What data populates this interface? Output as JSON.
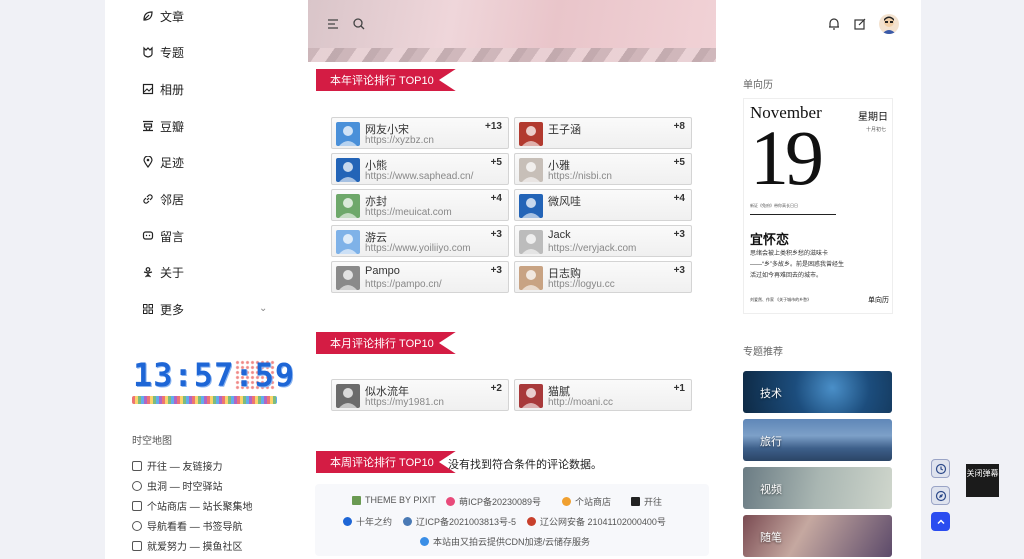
{
  "nav": [
    {
      "label": "文章",
      "icon": "leaf-icon"
    },
    {
      "label": "专题",
      "icon": "badge-icon"
    },
    {
      "label": "相册",
      "icon": "image-icon"
    },
    {
      "label": "豆瓣",
      "icon": "douban-icon"
    },
    {
      "label": "足迹",
      "icon": "map-pin-icon"
    },
    {
      "label": "邻居",
      "icon": "link-icon"
    },
    {
      "label": "留言",
      "icon": "chat-icon"
    },
    {
      "label": "关于",
      "icon": "person-icon"
    },
    {
      "label": "更多",
      "icon": "grid-icon"
    }
  ],
  "clock": "13:57:59",
  "shortcuts_title": "时空地图",
  "shortcuts": [
    "开往 — 友链接力",
    "虫洞 — 时空驿站",
    "个站商店 — 站长聚集地",
    "导航看看 — 书签导航",
    "就爱努力 — 摸鱼社区"
  ],
  "sections": {
    "year_title": "本年评论排行 TOP10",
    "month_title": "本月评论排行 TOP10",
    "week_title": "本周评论排行 TOP10",
    "week_empty": "没有找到符合条件的评论数据。"
  },
  "year_rank": [
    {
      "name": "网友小宋",
      "url": "https://xyzbz.cn",
      "count": "+13",
      "color": "#4a90d9"
    },
    {
      "name": "王子涵",
      "url": "",
      "count": "+8",
      "color": "#b23a2f"
    },
    {
      "name": "小熊",
      "url": "https://www.saphead.cn/",
      "count": "+5",
      "color": "#2364b7"
    },
    {
      "name": "小雅",
      "url": "https://nisbi.cn",
      "count": "+5",
      "color": "#c7bfb8"
    },
    {
      "name": "亦封",
      "url": "https://meuicat.com",
      "count": "+4",
      "color": "#6ea86a"
    },
    {
      "name": "微风哇",
      "url": "",
      "count": "+4",
      "color": "#2364b7"
    },
    {
      "name": "游云",
      "url": "https://www.yoiliiyo.com",
      "count": "+3",
      "color": "#7fb2e8"
    },
    {
      "name": "Jack",
      "url": "https://veryjack.com",
      "count": "+3",
      "color": "#bcbcbc"
    },
    {
      "name": "Pampo",
      "url": "https://pampo.cn/",
      "count": "+3",
      "color": "#8a8a8a"
    },
    {
      "name": "日志购",
      "url": "https://logyu.cc",
      "count": "+3",
      "color": "#c8a383"
    }
  ],
  "month_rank": [
    {
      "name": "似水流年",
      "url": "https://my1981.cn",
      "count": "+2",
      "color": "#6b6b6b"
    },
    {
      "name": "猫腻",
      "url": "http://moani.cc",
      "count": "+1",
      "color": "#a8393a"
    }
  ],
  "footer": {
    "theme": "THEME BY PIXIT",
    "moe": "萌ICP备20230089号",
    "shop": "个站商店",
    "travel": "开往",
    "ten_year": "十年之约",
    "icp": "辽ICP备2021003813号-5",
    "police": "辽公网安备 21041102000400号",
    "cdn": "本站由又拍云提供CDN加速/云储存服务"
  },
  "calendar": {
    "title": "单向历",
    "month": "November",
    "day": "19",
    "weekday": "星期日",
    "lunar": "十月初七",
    "small_text": "新证《兔府》带你高长日日",
    "yi": "宜怀恋",
    "text": "思绪会被上类积乡愁的滋味卡——“乡”多故乡。前是困惑我曾经生活过如今再难回去的城市。",
    "foot": "刘爱然、作家 《关于城市的乡愁》",
    "brand": "单向历"
  },
  "topics_title": "专题推荐",
  "topics": [
    {
      "label": "技术"
    },
    {
      "label": "旅行"
    },
    {
      "label": "视频"
    },
    {
      "label": "随笔"
    }
  ],
  "tooltip": "关闭弹幕"
}
